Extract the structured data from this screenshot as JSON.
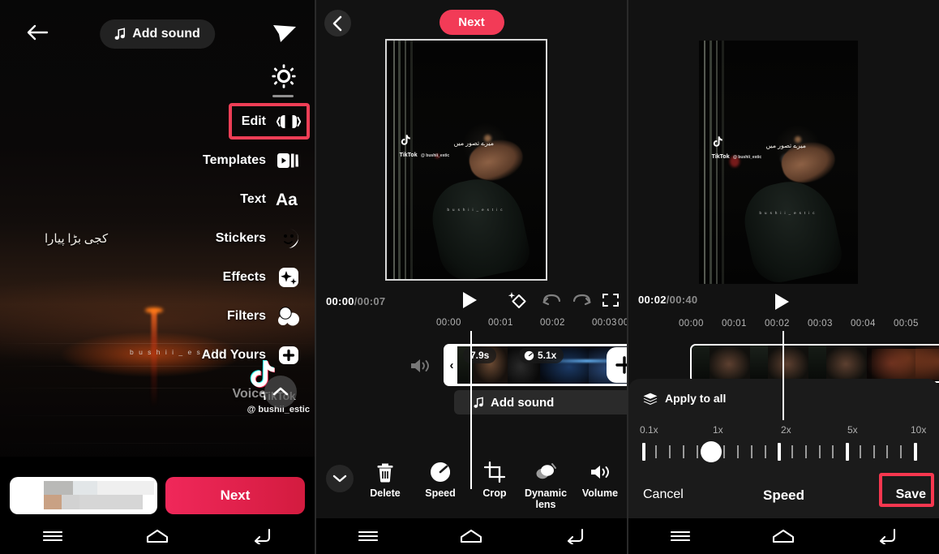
{
  "left_panel": {
    "back_icon": "arrow-left-icon",
    "add_sound_label": "Add sound",
    "music_icon": "music-note-icon",
    "send_icon": "send-icon",
    "brightness_icon": "sun-icon",
    "menu_items": [
      {
        "label": "Edit",
        "icon": "edit-clip-icon",
        "highlighted": true
      },
      {
        "label": "Templates",
        "icon": "templates-icon",
        "highlighted": false
      },
      {
        "label": "Text",
        "icon": "text-aa-icon",
        "highlighted": false
      },
      {
        "label": "Stickers",
        "icon": "stickers-icon",
        "highlighted": false
      },
      {
        "label": "Effects",
        "icon": "effects-sparkle-icon",
        "highlighted": false
      },
      {
        "label": "Filters",
        "icon": "filters-circles-icon",
        "highlighted": false
      },
      {
        "label": "Add Yours",
        "icon": "plus-square-icon",
        "highlighted": false
      },
      {
        "label": "Voice",
        "icon": "voice-icon",
        "highlighted": false
      }
    ],
    "watermark_urdu": "کجی بڑا پیارا",
    "watermark_user": "b u s h i i _ e s t i c",
    "tiktok_watermark": {
      "name": "TikTok",
      "handle": "@ bushii_estic"
    },
    "collapse_icon": "chevron-up-icon",
    "caption_placeholder": "",
    "next_label": "Next"
  },
  "middle_panel": {
    "back_icon": "chevron-left-icon",
    "next_label": "Next",
    "preview": {
      "urdu_text": "میرے تصور میں",
      "tiktok_name": "TikTok",
      "tiktok_handle": "@ bushii_estic",
      "username": "b u s h i i _ e s t i c"
    },
    "current_time": "00:00",
    "total_time": "/00:07",
    "controls": [
      {
        "name": "play-button",
        "icon": "play-icon"
      },
      {
        "name": "magic-effect-button",
        "icon": "sparkle-diamond-icon"
      },
      {
        "name": "undo-button",
        "icon": "undo-icon"
      },
      {
        "name": "redo-button",
        "icon": "redo-icon"
      },
      {
        "name": "fullscreen-button",
        "icon": "fullscreen-icon"
      }
    ],
    "timeline_ticks": [
      "00:00",
      "00:01",
      "00:02",
      "00:03",
      "00"
    ],
    "clip": {
      "duration_badge": "7.9s",
      "speed_badge": "5.1x",
      "speed_icon": "speedometer-icon",
      "add_clip_icon": "plus-icon",
      "volume_icon": "speaker-icon",
      "handle_icon": "chevron-left-icon"
    },
    "add_sound_label": "Add sound",
    "collapse_icon": "chevron-down-icon",
    "tools": [
      {
        "label": "Delete",
        "icon": "trash-icon",
        "highlighted": false
      },
      {
        "label": "Speed",
        "icon": "speedometer-icon",
        "highlighted": true
      },
      {
        "label": "Crop",
        "icon": "crop-icon",
        "highlighted": false
      },
      {
        "label": "Dynamic lens",
        "icon": "dynamic-lens-icon",
        "highlighted": false
      },
      {
        "label": "Volume",
        "icon": "speaker-icon",
        "highlighted": false
      }
    ]
  },
  "right_panel": {
    "current_time": "00:02",
    "total_time": "/00:40",
    "play_icon": "play-icon",
    "timeline_ticks": [
      "00:00",
      "00:01",
      "00:02",
      "00:03",
      "00:04",
      "00:05"
    ],
    "apply_to_all_label": "Apply to all",
    "apply_to_all_icon": "layers-icon",
    "speed_slider": {
      "labels": [
        "0.1x",
        "1x",
        "2x",
        "5x",
        "10x"
      ],
      "current_value": "1x",
      "min": "0.1x",
      "max": "10x"
    },
    "cancel_label": "Cancel",
    "title": "Speed",
    "save_label": "Save",
    "save_highlighted": true
  },
  "android_nav": {
    "menu_icon": "hamburger-icon",
    "home_icon": "home-icon",
    "back_icon": "back-arrow-icon"
  },
  "colors": {
    "accent_pink": "#f23b57",
    "highlight_red": "#f7374f",
    "sheet_bg": "#1b1b1b",
    "panel_bg": "#121212"
  }
}
